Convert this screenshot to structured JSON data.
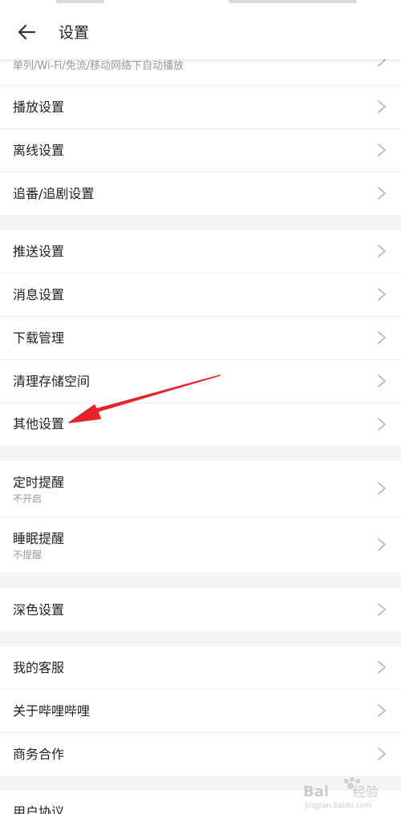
{
  "header": {
    "title": "设置"
  },
  "partial_row": {
    "subtitle": "单列/Wi-Fi/免流/移动网络下自动播放"
  },
  "rows": [
    {
      "label": "播放设置"
    },
    {
      "label": "离线设置"
    },
    {
      "label": "追番/追剧设置"
    },
    {
      "label": "推送设置"
    },
    {
      "label": "消息设置"
    },
    {
      "label": "下载管理"
    },
    {
      "label": "清理存储空间"
    },
    {
      "label": "其他设置"
    },
    {
      "label": "定时提醒",
      "sub": "不开启"
    },
    {
      "label": "睡眠提醒",
      "sub": "不提醒"
    },
    {
      "label": "深色设置"
    },
    {
      "label": "我的客服"
    },
    {
      "label": "关于哔哩哔哩"
    },
    {
      "label": "商务合作"
    },
    {
      "label": "用户协议"
    }
  ],
  "watermark": {
    "brand": "Bai",
    "brand2": "经验",
    "url": "jingyan.baidu.com"
  },
  "colors": {
    "arrow": "#e8222a",
    "chevron": "#b3b3b3",
    "section_gap": "#f4f4f4"
  }
}
